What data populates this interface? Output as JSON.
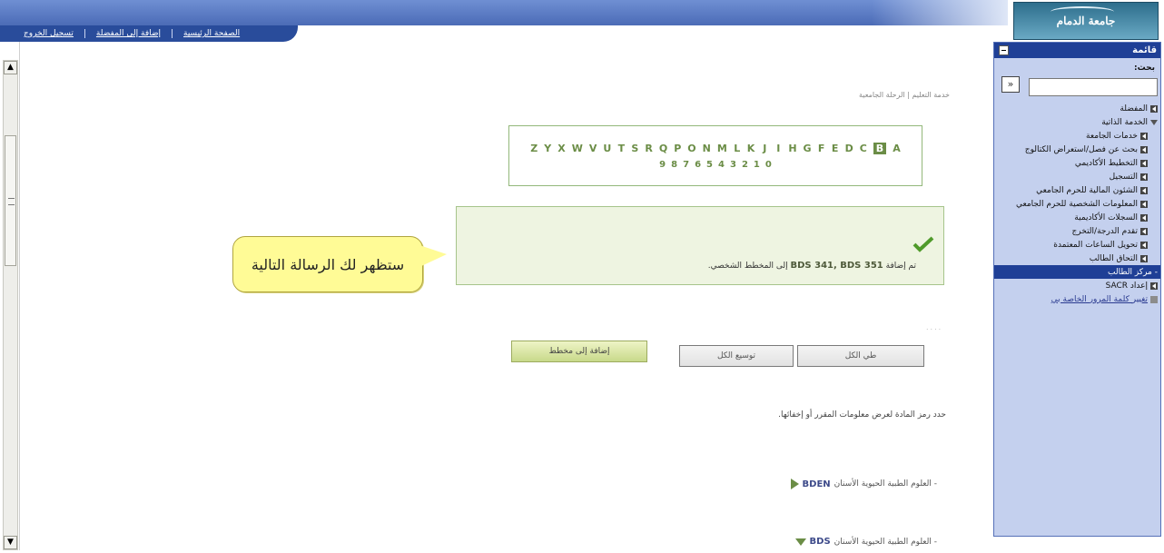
{
  "header": {
    "logo_text": "جامعة الدمام",
    "links": [
      "الصفحة الرئيسية",
      "إضافة إلى المفضلة",
      "تسجيل الخروج"
    ]
  },
  "breadcrumb": "خدمة التعليم | الرحلة الجامعية",
  "alphabet": {
    "letters": [
      "Z",
      "Y",
      "X",
      "W",
      "V",
      "U",
      "T",
      "S",
      "R",
      "Q",
      "P",
      "O",
      "N",
      "M",
      "L",
      "K",
      "J",
      "I",
      "H",
      "G",
      "F",
      "E",
      "D",
      "C",
      "B",
      "A"
    ],
    "selected": "B",
    "digits": [
      "9",
      "8",
      "7",
      "6",
      "5",
      "4",
      "3",
      "2",
      "1",
      "0"
    ]
  },
  "message": {
    "prefix": "تم إضافة",
    "courses": "BDS 341, BDS 351",
    "suffix": "إلى المخطط الشخصي."
  },
  "callout": {
    "text": "ستظهر لك الرسالة التالية"
  },
  "buttons": {
    "add_to_plan": "إضافة إلى مخطط",
    "expand_all": "توسيع الكل",
    "collapse_all": "طي الكل"
  },
  "instructions": "حدد رمز المادة لعرض معلومات المقرر أو إخفائها.",
  "subjects": [
    {
      "code": "BDEN",
      "name": "- العلوم الطبية الحيوية الأسنان"
    },
    {
      "code": "BDS",
      "name": "- العلوم الطبية الحيوية الأسنان"
    }
  ],
  "sidebar": {
    "title": "قائمة",
    "search_label": "بحث:",
    "search_button": "»",
    "items": [
      {
        "label": "المفضلة",
        "type": "arrow"
      },
      {
        "label": "الخدمة الذاتية",
        "type": "open"
      },
      {
        "label": "خدمات الجامعة",
        "type": "arrow-sub"
      },
      {
        "label": "بحث عن فصل/استعراض الكتالوج",
        "type": "arrow-sub"
      },
      {
        "label": "التخطيط الأكاديمي",
        "type": "arrow-sub"
      },
      {
        "label": "التسجيل",
        "type": "arrow-sub"
      },
      {
        "label": "الشئون المالية للحرم الجامعي",
        "type": "arrow-sub"
      },
      {
        "label": "المعلومات الشخصية للحرم الجامعي",
        "type": "arrow-sub"
      },
      {
        "label": "السجلات الأكاديمية",
        "type": "arrow-sub"
      },
      {
        "label": "تقدم الدرجة/التخرج",
        "type": "arrow-sub"
      },
      {
        "label": "تحويل الساعات المعتمدة",
        "type": "arrow-sub"
      },
      {
        "label": "التحاق الطالب",
        "type": "arrow-sub"
      },
      {
        "label": "- مركز الطالب",
        "type": "active"
      },
      {
        "label": "إعداد SACR",
        "type": "arrow"
      },
      {
        "label": "تغيير كلمة المرور الخاصة بي",
        "type": "link"
      }
    ]
  }
}
